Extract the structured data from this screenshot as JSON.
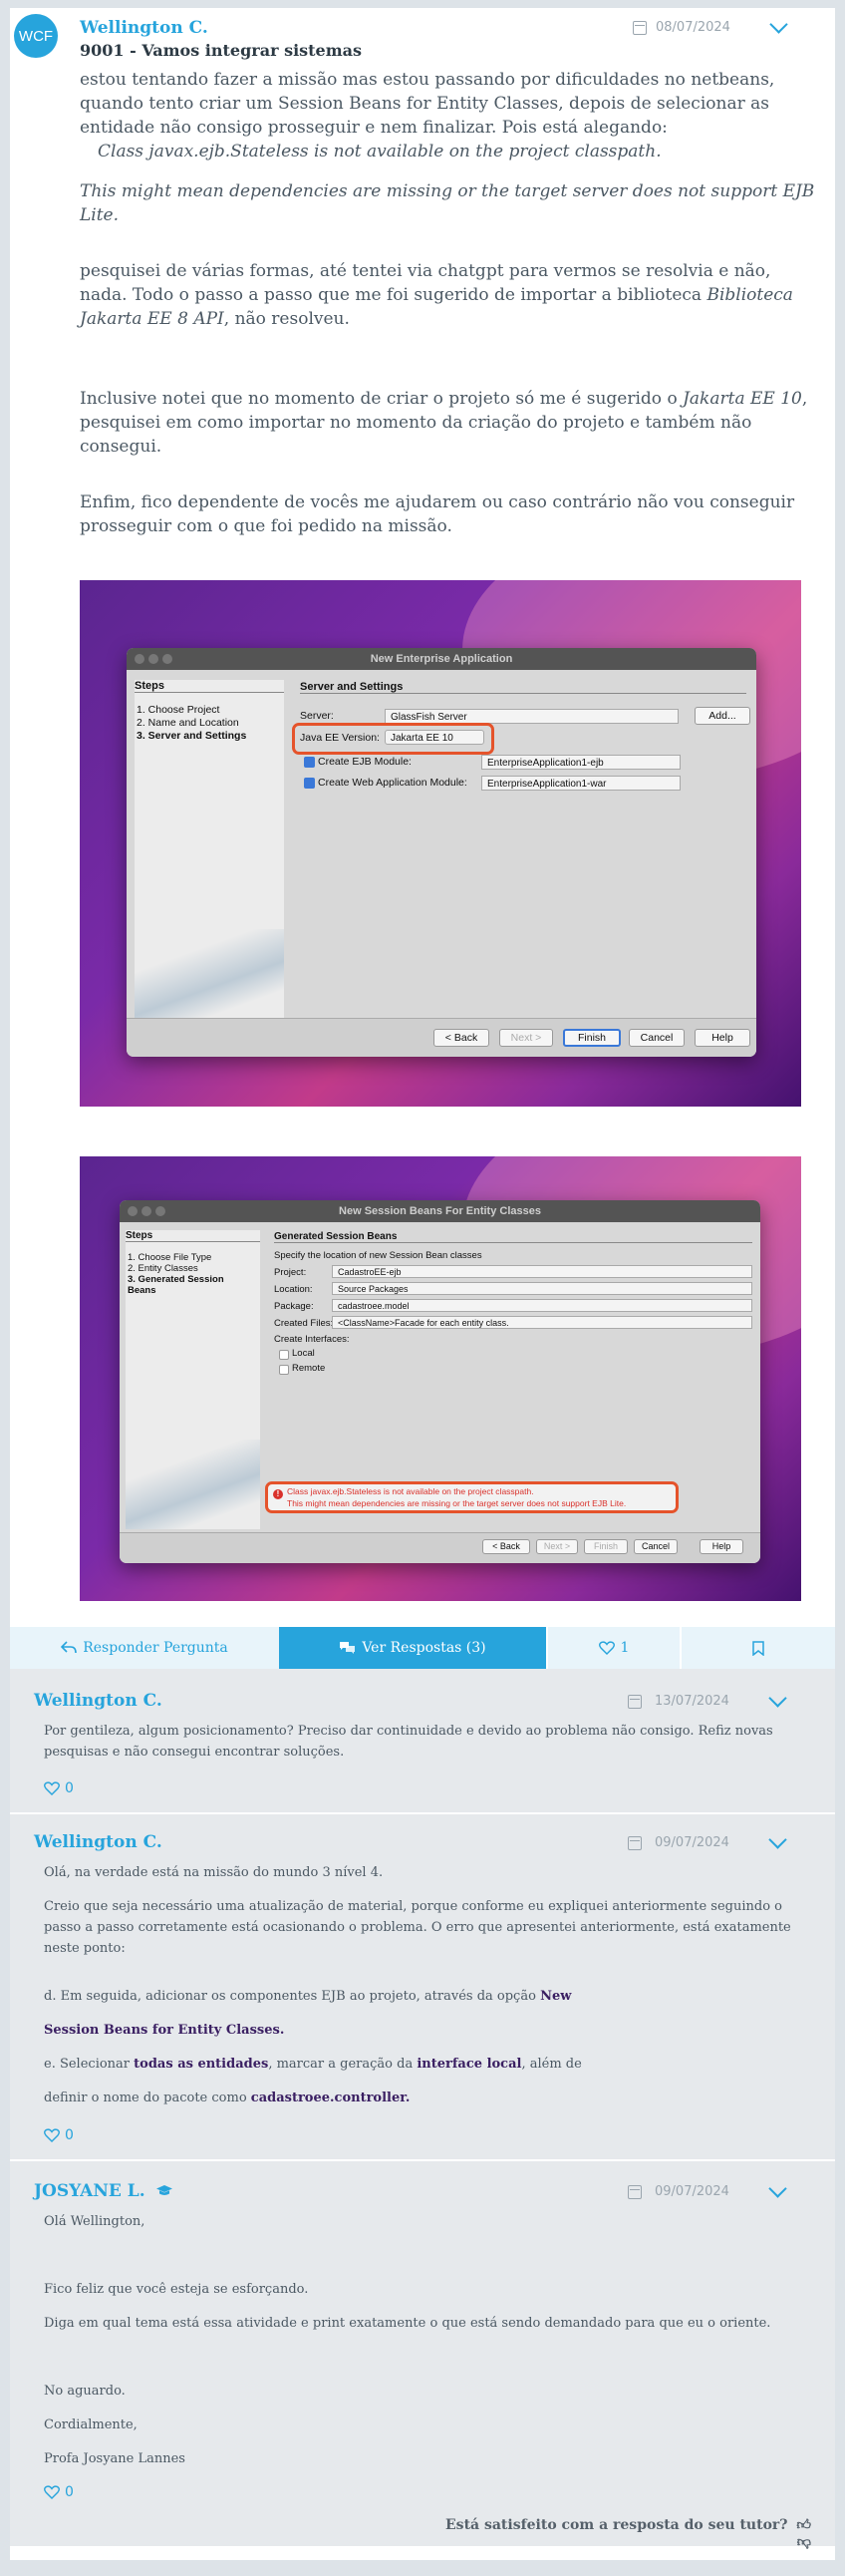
{
  "post": {
    "avatar_initials": "WCF",
    "author": "Wellington C.",
    "date": "08/07/2024",
    "topic": "9001 - Vamos integrar sistemas",
    "p1": "estou tentando fazer a missão mas estou passando por dificuldades no netbeans, quando tento criar um Session Beans for Entity Classes, depois de selecionar as entidade não consigo prosseguir e nem finalizar. Pois está alegando:",
    "q1": "Class javax.ejb.Stateless is not available on the project classpath.",
    "q2": "This might mean dependencies are missing or the target server does not support EJB Lite.",
    "p2a": "pesquisei de várias formas, até tentei via chatgpt para vermos se resolvia e não, nada. Todo o passo a passo que me foi sugerido de importar a biblioteca ",
    "p2i": "Biblioteca Jakarta EE 8 API",
    "p2b": ", não resolveu.",
    "p3a": "Inclusive notei que no momento de criar o projeto só me é sugerido o ",
    "p3i": "Jakarta EE 10",
    "p3b": ", pesquisei em como importar no momento da criação do projeto e também não consegui.",
    "p4": "Enfim, fico dependente de vocês me ajudarem ou caso contrário não vou conseguir prosseguir com o que foi pedido na missão."
  },
  "shot1": {
    "title": "New Enterprise Application",
    "steps_title": "Steps",
    "steps": [
      "1.   Choose Project",
      "2.   Name and Location",
      "3.   Server and Settings"
    ],
    "panel_title": "Server and Settings",
    "server_label": "Server:",
    "server_value": "GlassFish Server",
    "add_btn": "Add...",
    "javaee_label": "Java EE Version:",
    "javaee_value": "Jakarta EE 10",
    "ejb_label": "Create EJB Module:",
    "ejb_value": "EnterpriseApplication1-ejb",
    "web_label": "Create Web Application Module:",
    "web_value": "EnterpriseApplication1-war",
    "back": "< Back",
    "next": "Next >",
    "finish": "Finish",
    "cancel": "Cancel",
    "help": "Help"
  },
  "shot2": {
    "title": "New Session Beans For Entity Classes",
    "steps_title": "Steps",
    "steps": [
      "1.   Choose File Type",
      "2.   Entity Classes",
      "3.   Generated Session",
      "      Beans"
    ],
    "panel_title": "Generated Session Beans",
    "intro": "Specify the location of new Session Bean classes",
    "project_label": "Project:",
    "project_value": "CadastroEE-ejb",
    "location_label": "Location:",
    "location_value": "Source Packages",
    "package_label": "Package:",
    "package_value": "cadastroee.model",
    "created_label": "Created Files:",
    "created_value": "<ClassName>Facade for each entity class.",
    "interfaces_label": "Create Interfaces:",
    "local": "Local",
    "remote": "Remote",
    "error1": "Class javax.ejb.Stateless is not available on the project classpath.",
    "error2": "This might mean dependencies are missing or the target server does not support EJB Lite.",
    "back": "< Back",
    "next": "Next >",
    "finish": "Finish",
    "cancel": "Cancel",
    "help": "Help"
  },
  "actions": {
    "reply": "Responder Pergunta",
    "view": "Ver Respostas (3)",
    "likes": "1"
  },
  "replies": [
    {
      "author": "Wellington C.",
      "date": "13/07/2024",
      "text": "Por gentileza, algum posicionamento? Preciso dar continuidade e devido ao problema não consigo. Refiz novas pesquisas e não consegui encontrar soluções.",
      "likes": "0"
    },
    {
      "author": "Wellington C.",
      "date": "09/07/2024",
      "l1": "Olá, na verdade está na missão do mundo 3 nível 4.",
      "l2": "Creio que seja necessário uma atualização de material, porque conforme eu expliquei anteriormente seguindo o passo a passo corretamente está ocasionando o problema. O erro que apresentei anteriormente, está exatamente neste ponto:",
      "l3a": "d. Em seguida, adicionar os componentes EJB ao projeto, através da opção ",
      "l3b": "New",
      "l4": "Session Beans for Entity Classes.",
      "l5a": "e. Selecionar ",
      "l5b": "todas as entidades",
      "l5c": ", marcar a geração da ",
      "l5d": "interface local",
      "l5e": ", além de",
      "l6a": "definir o nome do pacote como ",
      "l6b": "cadastroee.controller.",
      "likes": "0"
    },
    {
      "author": "JOSYANE L.",
      "date": "09/07/2024",
      "l1": "Olá Wellington,",
      "l2": "Fico feliz que você esteja se esforçando.",
      "l3": "Diga em qual tema está essa atividade e print exatamente o que está sendo demandado para que eu o oriente.",
      "l4": "No aguardo.",
      "l5": "Cordialmente,",
      "l6": "Profa Josyane Lannes",
      "likes": "0",
      "satisfaction": "Está satisfeito com a resposta do seu tutor?"
    }
  ]
}
